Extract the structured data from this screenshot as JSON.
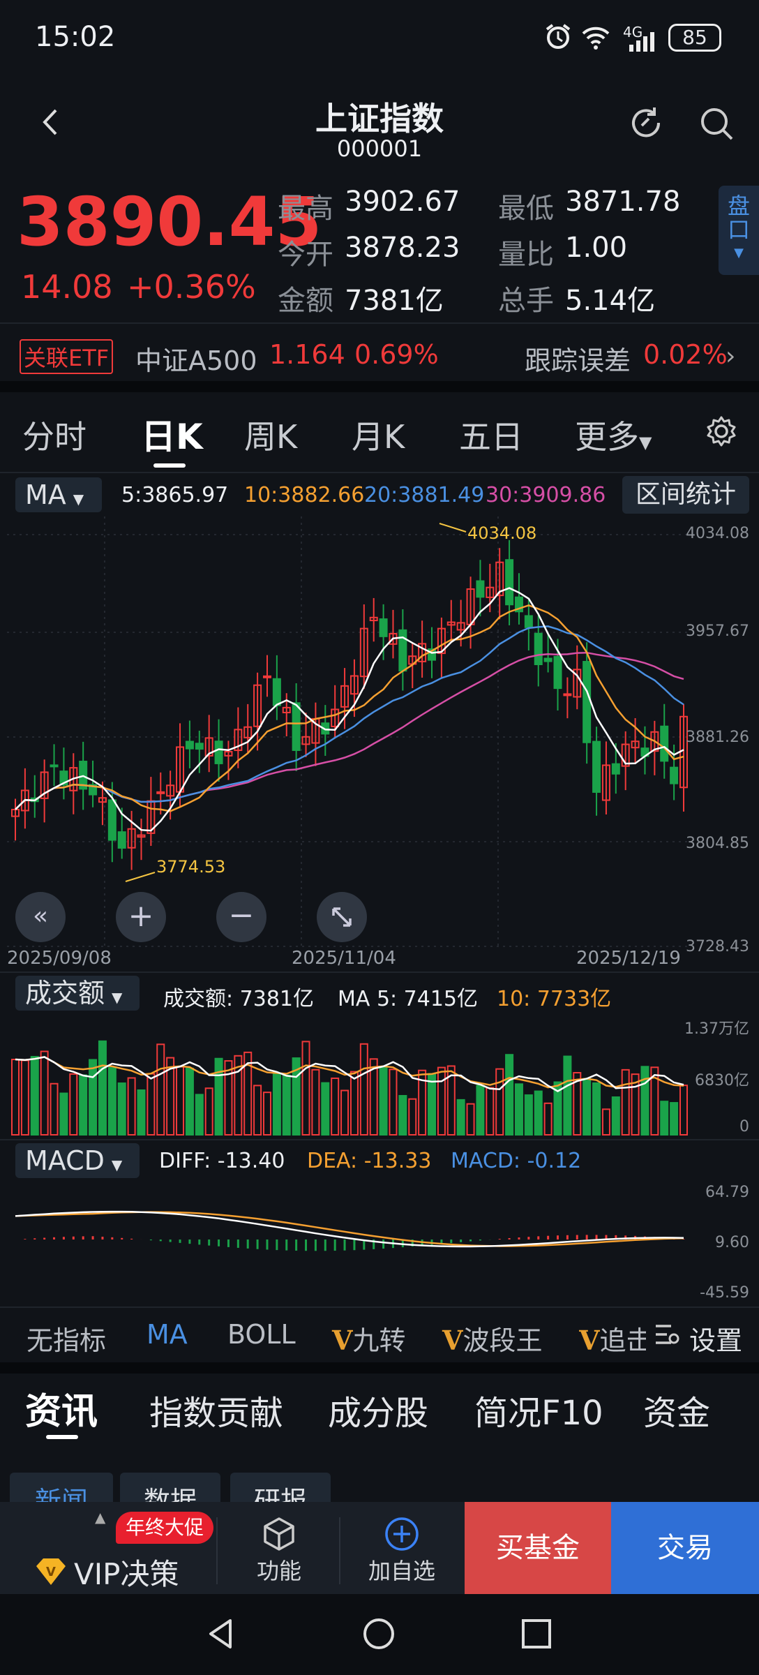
{
  "status_bar": {
    "time": "15:02",
    "battery": "85",
    "signal": "4G"
  },
  "header": {
    "title": "上证指数",
    "code": "000001"
  },
  "quote": {
    "price": "3890.45",
    "change": "14.08",
    "change_pct": "+0.36%",
    "high_label": "最高",
    "high": "3902.67",
    "low_label": "最低",
    "low": "3871.78",
    "open_label": "今开",
    "open": "3878.23",
    "ratio_label": "量比",
    "ratio": "1.00",
    "amount_label": "金额",
    "amount": "7381亿",
    "hands_label": "总手",
    "hands": "5.14亿",
    "side_tab": "盘口"
  },
  "etf": {
    "tag": "关联ETF",
    "name": "中证A500",
    "price": "1.164",
    "pct": "0.69%",
    "track_label": "跟踪误差",
    "track": "0.02%"
  },
  "period_tabs": [
    "分时",
    "日K",
    "周K",
    "月K",
    "五日",
    "更多"
  ],
  "ma_bar": {
    "selector": "MA",
    "ma5": "5:3865.97",
    "ma10": "10:3882.66",
    "ma20": "20:3881.49",
    "ma30": "30:3909.86",
    "stats_button": "区间统计"
  },
  "kline": {
    "y_ticks": [
      "4034.08",
      "3957.67",
      "3881.26",
      "3804.85",
      "3728.43"
    ],
    "high_mark": "4034.08",
    "low_mark": "3774.53",
    "dates": [
      "2025/09/08",
      "2025/11/04",
      "2025/12/19"
    ]
  },
  "volume": {
    "selector": "成交额",
    "label": "成交额: 7381亿",
    "ma5": "MA 5: 7415亿",
    "ma10": "10: 7733亿",
    "y_ticks": [
      "1.37万亿",
      "6830亿",
      "0"
    ]
  },
  "macd": {
    "selector": "MACD",
    "diff": "DIFF: -13.40",
    "dea": "DEA: -13.33",
    "macd": "MACD: -0.12",
    "y_ticks": [
      "64.79",
      "9.60",
      "-45.59"
    ]
  },
  "indicators": [
    "无指标",
    "MA",
    "BOLL",
    "九转",
    "波段王",
    "追击"
  ],
  "indicator_settings": "设置",
  "bottom_tabs": [
    "资讯",
    "指数贡献",
    "成分股",
    "简况F10",
    "资金"
  ],
  "sub_tabs": [
    "新闻",
    "数据",
    "研报"
  ],
  "action_bar": {
    "vip_label": "VIP决策",
    "promo": "年终大促",
    "func_label": "功能",
    "add_label": "加自选",
    "buy_fund": "买基金",
    "trade": "交易"
  },
  "colors": {
    "up": "#f03a3a",
    "down": "#1aa34a",
    "ma5": "#ffffff",
    "ma10": "#f5a031",
    "ma20": "#4a90e2",
    "ma30": "#d64fa6",
    "accent": "#3b82f6"
  }
}
